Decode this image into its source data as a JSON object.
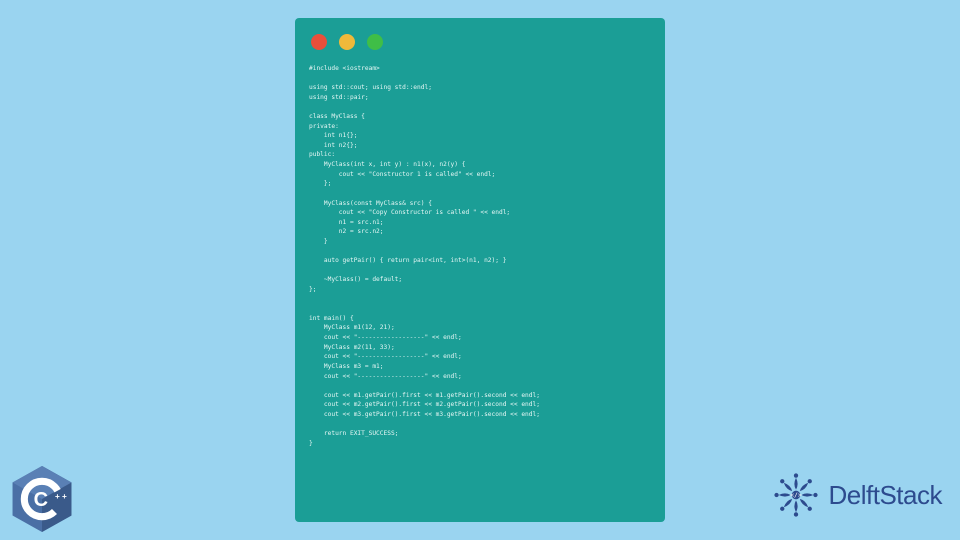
{
  "code_lines": [
    "#include <iostream>",
    "",
    "using std::cout; using std::endl;",
    "using std::pair;",
    "",
    "class MyClass {",
    "private:",
    "    int n1{};",
    "    int n2{};",
    "public:",
    "    MyClass(int x, int y) : n1(x), n2(y) {",
    "        cout << \"Constructor 1 is called\" << endl;",
    "    };",
    "",
    "    MyClass(const MyClass& src) {",
    "        cout << \"Copy Constructor is called \" << endl;",
    "        n1 = src.n1;",
    "        n2 = src.n2;",
    "    }",
    "",
    "    auto getPair() { return pair<int, int>(n1, n2); }",
    "",
    "    ~MyClass() = default;",
    "};",
    "",
    "",
    "int main() {",
    "    MyClass m1(12, 21);",
    "    cout << \"------------------\" << endl;",
    "    MyClass m2(11, 33);",
    "    cout << \"------------------\" << endl;",
    "    MyClass m3 = m1;",
    "    cout << \"------------------\" << endl;",
    "",
    "    cout << m1.getPair().first << m1.getPair().second << endl;",
    "    cout << m2.getPair().first << m2.getPair().second << endl;",
    "    cout << m3.getPair().first << m3.getPair().second << endl;",
    "",
    "    return EXIT_SUCCESS;",
    "}"
  ],
  "brand": {
    "name": "DelftStack"
  },
  "cpp_badge": {
    "label": "C++"
  }
}
